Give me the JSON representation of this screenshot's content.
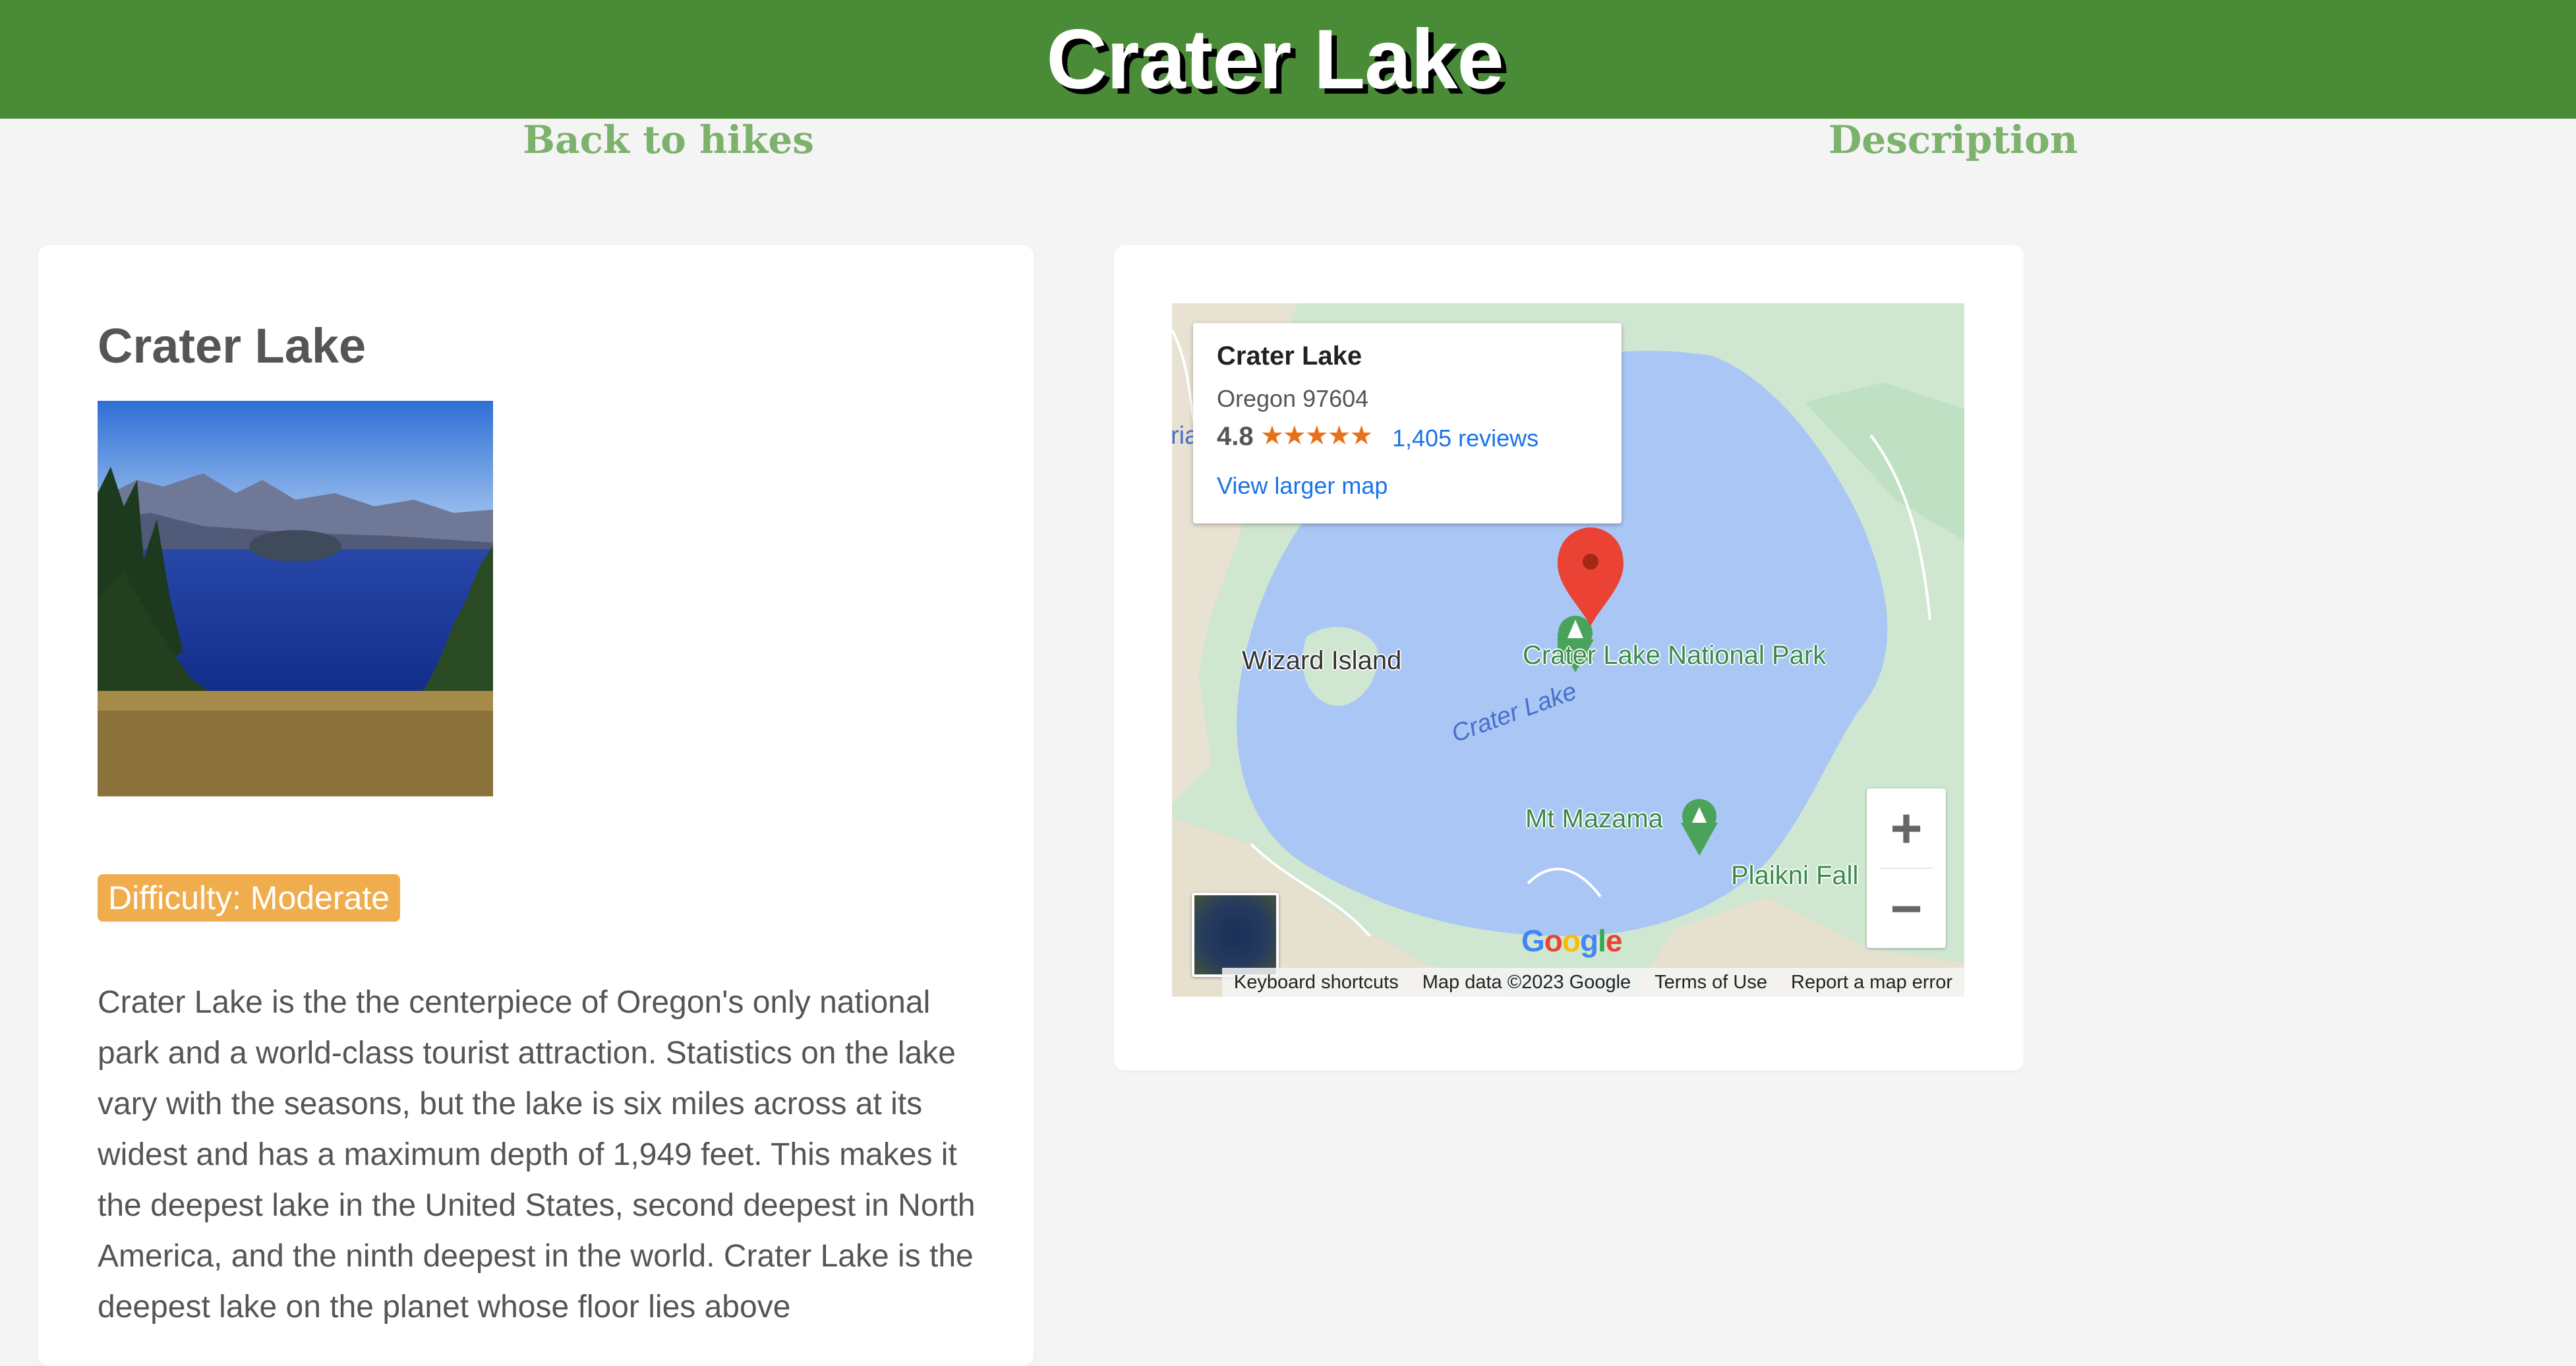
{
  "header": {
    "title": "Crater Lake"
  },
  "nav": {
    "back_label": "Back to hikes",
    "description_label": "Description"
  },
  "trail": {
    "title": "Crater Lake",
    "difficulty": "Difficulty: Moderate",
    "description": "Crater Lake is the the centerpiece of Oregon's only national park and a world-class tourist attraction. Statistics on the lake vary with the seasons, but the lake is six miles across at its widest and has a maximum depth of 1,949 feet. This makes it the deepest lake in the United States, second deepest in North America, and the ninth deepest in the world. Crater Lake is the deepest lake on the planet whose floor lies above"
  },
  "map": {
    "info_window": {
      "title": "Crater Lake",
      "address": "Oregon 97604",
      "rating": "4.8",
      "stars": "★★★★★",
      "reviews": "1,405 reviews",
      "larger_map": "View larger map"
    },
    "labels": {
      "wizard_island": "Wizard Island",
      "national_park": "Crater Lake National Park",
      "lake": "Crater Lake",
      "mt_mazama": "Mt Mazama",
      "plaikni": "Plaikni Fall",
      "ria": "ria"
    },
    "zoom_in": "+",
    "zoom_out": "−",
    "google": "Google",
    "footer": {
      "shortcuts": "Keyboard shortcuts",
      "map_data": "Map data ©2023 Google",
      "terms": "Terms of Use",
      "report": "Report a map error"
    }
  },
  "colors": {
    "header": "#4a8b38",
    "nav_link": "#7cb26c",
    "badge": "#f0ad4e",
    "lake": "#a9c6f5",
    "pin": "#ea4335"
  }
}
